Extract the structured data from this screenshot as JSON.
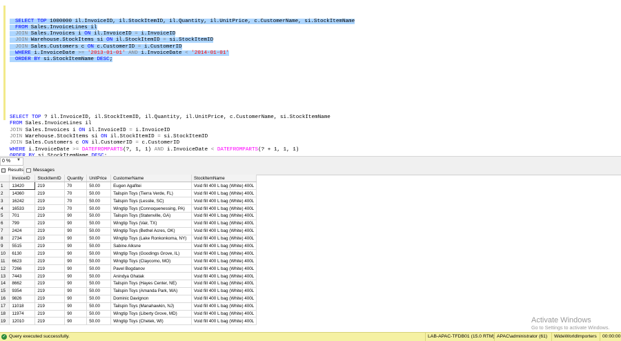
{
  "editor": {
    "query1_lines": [
      [
        {
          "t": "SELECT TOP ",
          "c": "kw"
        },
        {
          "t": "1000000 il.InvoiceID, il.StockItemID, il.Quantity, il.UnitPrice, c.CustomerName, si.StockItemName",
          "c": ""
        }
      ],
      [
        {
          "t": "FROM ",
          "c": "kw"
        },
        {
          "t": "Sales.InvoiceLines il",
          "c": ""
        }
      ],
      [
        {
          "t": "JOIN ",
          "c": "gr"
        },
        {
          "t": "Sales.Invoices i ",
          "c": ""
        },
        {
          "t": "ON ",
          "c": "kw"
        },
        {
          "t": "il.InvoiceID ",
          "c": ""
        },
        {
          "t": "= ",
          "c": "gr"
        },
        {
          "t": "i.InvoiceID",
          "c": ""
        }
      ],
      [
        {
          "t": "JOIN ",
          "c": "gr"
        },
        {
          "t": "Warehouse.StockItems si ",
          "c": ""
        },
        {
          "t": "ON ",
          "c": "kw"
        },
        {
          "t": "il.StockItemID ",
          "c": ""
        },
        {
          "t": "= ",
          "c": "gr"
        },
        {
          "t": "si.StockItemID",
          "c": ""
        }
      ],
      [
        {
          "t": "JOIN ",
          "c": "gr"
        },
        {
          "t": "Sales.Customers c ",
          "c": ""
        },
        {
          "t": "ON ",
          "c": "kw"
        },
        {
          "t": "c.CustomerID ",
          "c": ""
        },
        {
          "t": "= ",
          "c": "gr"
        },
        {
          "t": "i.CustomerID",
          "c": ""
        }
      ],
      [
        {
          "t": "WHERE ",
          "c": "kw"
        },
        {
          "t": "i.InvoiceDate ",
          "c": ""
        },
        {
          "t": ">= ",
          "c": "gr"
        },
        {
          "t": "'2013-01-01' ",
          "c": "str"
        },
        {
          "t": "AND ",
          "c": "gr"
        },
        {
          "t": "i.InvoiceDate ",
          "c": ""
        },
        {
          "t": "< ",
          "c": "gr"
        },
        {
          "t": "'2014-01-01'",
          "c": "str"
        }
      ],
      [
        {
          "t": "ORDER BY ",
          "c": "kw"
        },
        {
          "t": "si.StockItemName ",
          "c": ""
        },
        {
          "t": "DESC",
          "c": "kw"
        },
        {
          "t": ";",
          "c": ""
        }
      ]
    ],
    "query2_lines": [
      [
        {
          "t": "SELECT TOP ",
          "c": "kw"
        },
        {
          "t": "? il.InvoiceID, il.StockItemID, il.Quantity, il.UnitPrice, c.CustomerName, si.StockItemName",
          "c": ""
        }
      ],
      [
        {
          "t": "FROM ",
          "c": "kw"
        },
        {
          "t": "Sales.InvoiceLines il",
          "c": ""
        }
      ],
      [
        {
          "t": "JOIN ",
          "c": "gr"
        },
        {
          "t": "Sales.Invoices i ",
          "c": ""
        },
        {
          "t": "ON ",
          "c": "kw"
        },
        {
          "t": "il.InvoiceID ",
          "c": ""
        },
        {
          "t": "= ",
          "c": "gr"
        },
        {
          "t": "i.InvoiceID",
          "c": ""
        }
      ],
      [
        {
          "t": "JOIN ",
          "c": "gr"
        },
        {
          "t": "Warehouse.StockItems si ",
          "c": ""
        },
        {
          "t": "ON ",
          "c": "kw"
        },
        {
          "t": "il.StockItemID ",
          "c": ""
        },
        {
          "t": "= ",
          "c": "gr"
        },
        {
          "t": "si.StockItemID",
          "c": ""
        }
      ],
      [
        {
          "t": "JOIN ",
          "c": "gr"
        },
        {
          "t": "Sales.Customers c ",
          "c": ""
        },
        {
          "t": "ON ",
          "c": "kw"
        },
        {
          "t": "il.CustomerID ",
          "c": ""
        },
        {
          "t": "= ",
          "c": "gr"
        },
        {
          "t": "c.CustomerID",
          "c": ""
        }
      ],
      [
        {
          "t": "WHERE ",
          "c": "kw"
        },
        {
          "t": "i.InvoiceDate ",
          "c": ""
        },
        {
          "t": ">= ",
          "c": "gr"
        },
        {
          "t": "DATEFROMPARTS",
          "c": "fn"
        },
        {
          "t": "(?, 1, 1) ",
          "c": ""
        },
        {
          "t": "AND ",
          "c": "gr"
        },
        {
          "t": "i.InvoiceDate ",
          "c": ""
        },
        {
          "t": "< ",
          "c": "gr"
        },
        {
          "t": "DATEFROMPARTS",
          "c": "fn"
        },
        {
          "t": "(? + 1, 1, 1)",
          "c": ""
        }
      ],
      [
        {
          "t": "ORDER BY ",
          "c": "kw"
        },
        {
          "t": "si.StockItemName ",
          "c": ""
        },
        {
          "t": "DESC",
          "c": "kw"
        },
        {
          "t": ";",
          "c": ""
        }
      ]
    ]
  },
  "zoom": {
    "value": "0 %"
  },
  "tabs": {
    "results": "Results",
    "messages": "Messages"
  },
  "grid": {
    "columns": [
      "InvoiceID",
      "StockItemID",
      "Quantity",
      "UnitPrice",
      "CustomerName",
      "StockItemName"
    ],
    "rows": [
      [
        "1",
        "13420",
        "219",
        "70",
        "50.00",
        "Eugen Agafitei",
        "Void fill 400 L bag (White) 400L"
      ],
      [
        "2",
        "14360",
        "219",
        "70",
        "50.00",
        "Tailspin Toys (Tierra Verde, FL)",
        "Void fill 400 L bag (White) 400L"
      ],
      [
        "3",
        "16242",
        "219",
        "70",
        "50.00",
        "Tailspin Toys (Lesslie, SC)",
        "Void fill 400 L bag (White) 400L"
      ],
      [
        "4",
        "16533",
        "219",
        "70",
        "50.00",
        "Wingtip Toys (Connoquenessing, PA)",
        "Void fill 400 L bag (White) 400L"
      ],
      [
        "5",
        "701",
        "219",
        "90",
        "50.00",
        "Tailspin Toys (Statenville, GA)",
        "Void fill 400 L bag (White) 400L"
      ],
      [
        "6",
        "799",
        "219",
        "90",
        "50.00",
        "Wingtip Toys (Vair, TX)",
        "Void fill 400 L bag (White) 400L"
      ],
      [
        "7",
        "2424",
        "219",
        "90",
        "50.00",
        "Wingtip Toys (Bethel Acres, OK)",
        "Void fill 400 L bag (White) 400L"
      ],
      [
        "8",
        "2734",
        "219",
        "90",
        "50.00",
        "Wingtip Toys (Lake Ronkonkoma, NY)",
        "Void fill 400 L bag (White) 400L"
      ],
      [
        "9",
        "5515",
        "219",
        "90",
        "50.00",
        "Sabine Alksne",
        "Void fill 400 L bag (White) 400L"
      ],
      [
        "10",
        "6130",
        "219",
        "90",
        "50.00",
        "Wingtip Toys (Goodings Grove, IL)",
        "Void fill 400 L bag (White) 400L"
      ],
      [
        "11",
        "6623",
        "219",
        "90",
        "50.00",
        "Wingtip Toys (Claycomo, MO)",
        "Void fill 400 L bag (White) 400L"
      ],
      [
        "12",
        "7266",
        "219",
        "90",
        "50.00",
        "Pavel Bogdanov",
        "Void fill 400 L bag (White) 400L"
      ],
      [
        "13",
        "7443",
        "219",
        "90",
        "50.00",
        "Anindya Ghatak",
        "Void fill 400 L bag (White) 400L"
      ],
      [
        "14",
        "8662",
        "219",
        "90",
        "50.00",
        "Tailspin Toys (Hayes Center, NE)",
        "Void fill 400 L bag (White) 400L"
      ],
      [
        "15",
        "9354",
        "219",
        "90",
        "50.00",
        "Tailspin Toys (Amanda Park, WA)",
        "Void fill 400 L bag (White) 400L"
      ],
      [
        "16",
        "9826",
        "219",
        "90",
        "50.00",
        "Dominic Davignon",
        "Void fill 400 L bag (White) 400L"
      ],
      [
        "17",
        "11018",
        "219",
        "90",
        "50.00",
        "Tailspin Toys (Manahawkin, NJ)",
        "Void fill 400 L bag (White) 400L"
      ],
      [
        "18",
        "11974",
        "219",
        "90",
        "50.00",
        "Wingtip Toys (Liberty Grove, MD)",
        "Void fill 400 L bag (White) 400L"
      ],
      [
        "19",
        "12010",
        "219",
        "90",
        "50.00",
        "Wingtip Toys (Chetek, WI)",
        "Void fill 400 L bag (White) 400L"
      ]
    ]
  },
  "watermark": {
    "line1": "Activate Windows",
    "line2": "Go to Settings to activate Windows."
  },
  "status": {
    "message": "Query executed successfully.",
    "server": "LAB-APAC-TFDB01 (15.0 RTM)",
    "user": "APAC\\administrator (61)",
    "database": "WideWorldImporters",
    "elapsed": "00:00:00"
  },
  "colors": {
    "keyword": "#0000ff",
    "string": "#ff0000",
    "function": "#ff00ff",
    "operator": "#808080",
    "selection": "#add6ff",
    "statusbar": "#f5f1a3"
  }
}
